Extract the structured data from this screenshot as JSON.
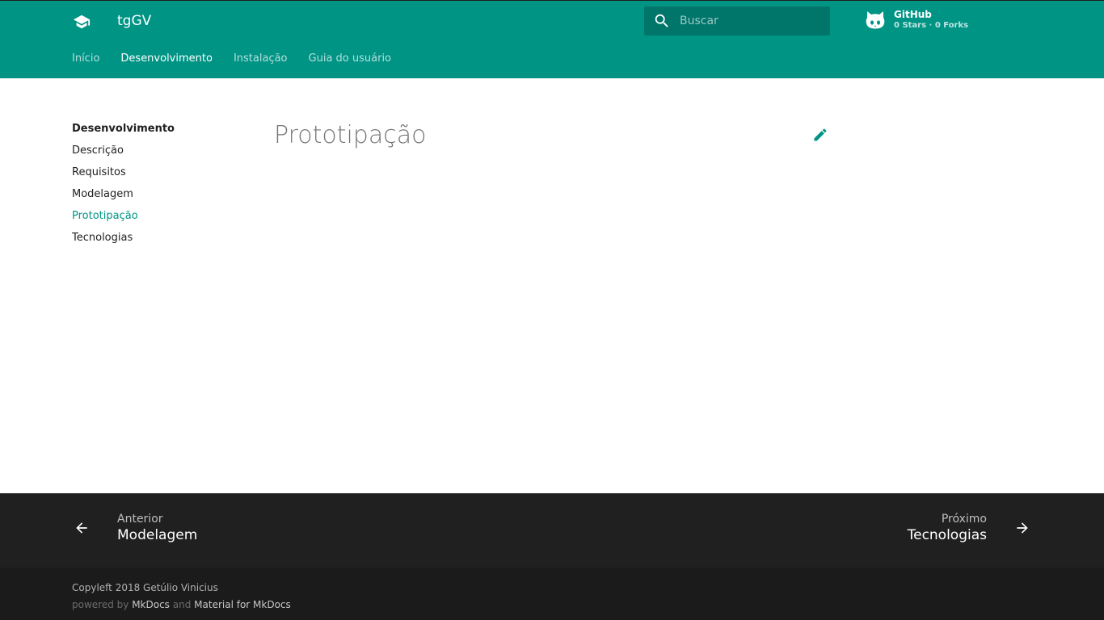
{
  "header": {
    "site_title": "tgGV",
    "logo_icon": "school-icon",
    "search": {
      "placeholder": "Buscar"
    },
    "repo": {
      "name": "GitHub",
      "stats": "0 Stars · 0 Forks",
      "icon": "octocat-icon"
    },
    "tabs": [
      {
        "label": "Início",
        "active": false
      },
      {
        "label": "Desenvolvimento",
        "active": true
      },
      {
        "label": "Instalação",
        "active": false
      },
      {
        "label": "Guia do usuário",
        "active": false
      }
    ]
  },
  "sidebar": {
    "title": "Desenvolvimento",
    "items": [
      {
        "label": "Descrição",
        "active": false
      },
      {
        "label": "Requisitos",
        "active": false
      },
      {
        "label": "Modelagem",
        "active": false
      },
      {
        "label": "Prototipação",
        "active": true
      },
      {
        "label": "Tecnologias",
        "active": false
      }
    ]
  },
  "content": {
    "title": "Prototipação",
    "edit_icon": "pencil-icon"
  },
  "footer_nav": {
    "prev": {
      "direction": "Anterior",
      "title": "Modelagem"
    },
    "next": {
      "direction": "Próximo",
      "title": "Tecnologias"
    }
  },
  "footer_meta": {
    "copyright": "Copyleft 2018 Getúlio Vinicius",
    "powered_by": "powered by",
    "mkdocs": "MkDocs",
    "and": "and",
    "material": "Material for MkDocs"
  },
  "colors": {
    "primary": "#009485",
    "search_bg": "#00756a",
    "footer_nav_bg": "#202020",
    "footer_meta_bg": "#1b1b1b"
  }
}
